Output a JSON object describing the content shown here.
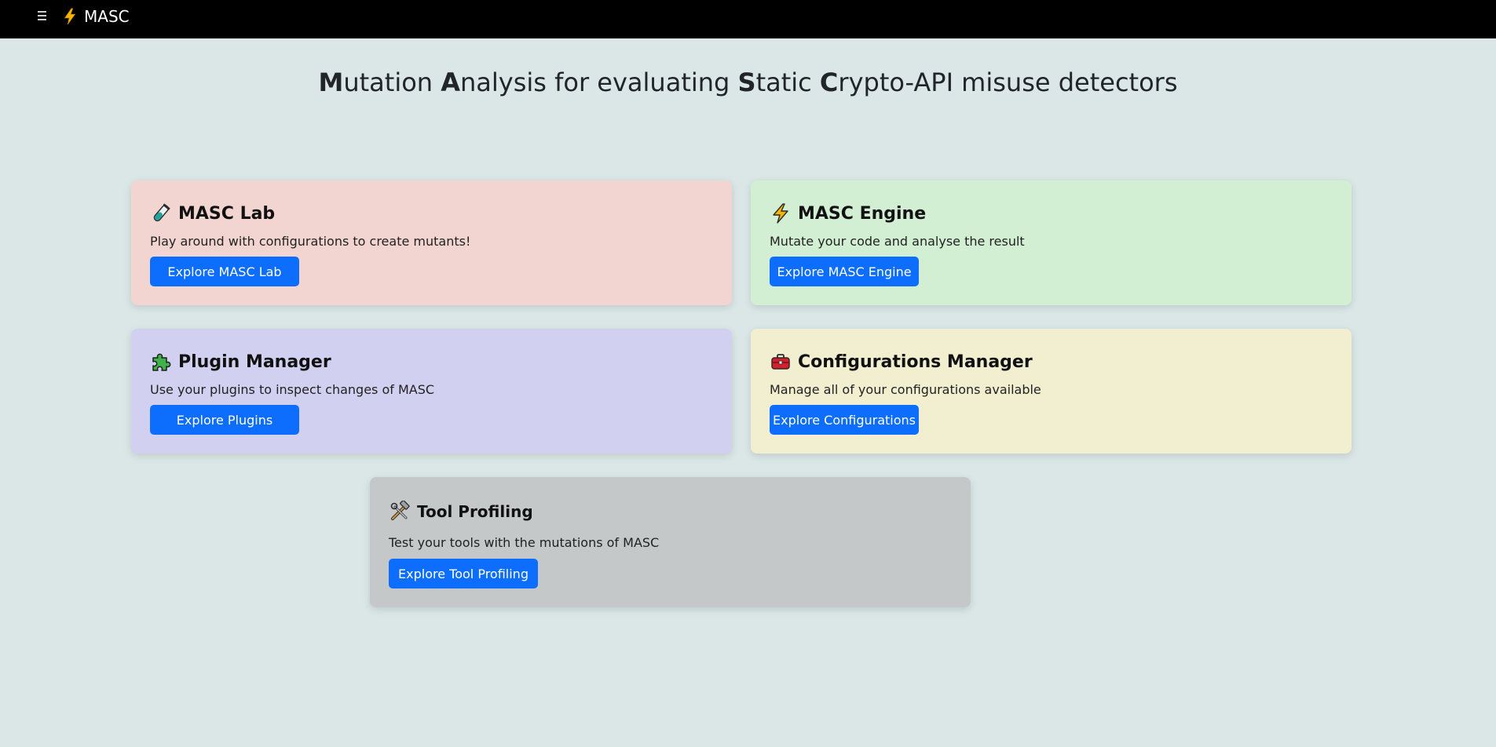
{
  "nav": {
    "brand": "MASC",
    "menu_icon": "hamburger-icon",
    "brand_icon": "lightning-icon"
  },
  "title": {
    "segments": [
      {
        "bold": "M",
        "rest": "utation "
      },
      {
        "bold": "A",
        "rest": "nalysis for evaluating "
      },
      {
        "bold": "S",
        "rest": "tatic "
      },
      {
        "bold": "C",
        "rest": "rypto-API misuse detectors"
      }
    ]
  },
  "cards": {
    "lab": {
      "icon": "test-tube-icon",
      "title": "MASC Lab",
      "text": "Play around with configurations to create mutants!",
      "button": "Explore MASC Lab",
      "color": "#f2d5d0"
    },
    "engine": {
      "icon": "lightning-icon",
      "title": "MASC Engine",
      "text": "Mutate your code and analyse the result",
      "button": "Explore MASC Engine",
      "color": "#d2efd3"
    },
    "plugin": {
      "icon": "puzzle-piece-icon",
      "title": "Plugin Manager",
      "text": "Use your plugins to inspect changes of MASC",
      "button": "Explore Plugins",
      "color": "#d2d0f0"
    },
    "config": {
      "icon": "toolbox-icon",
      "title": "Configurations Manager",
      "text": "Manage all of your configurations available",
      "button": "Explore Configurations",
      "color": "#f1efcf"
    },
    "tool": {
      "icon": "hammer-wrench-icon",
      "title": "Tool Profiling",
      "text": "Test your tools with the mutations of MASC",
      "button": "Explore Tool Profiling",
      "color": "#c5c8c8"
    }
  },
  "colors": {
    "background": "#dae7e6",
    "navbar": "#000000",
    "button": "#0d6efd"
  }
}
